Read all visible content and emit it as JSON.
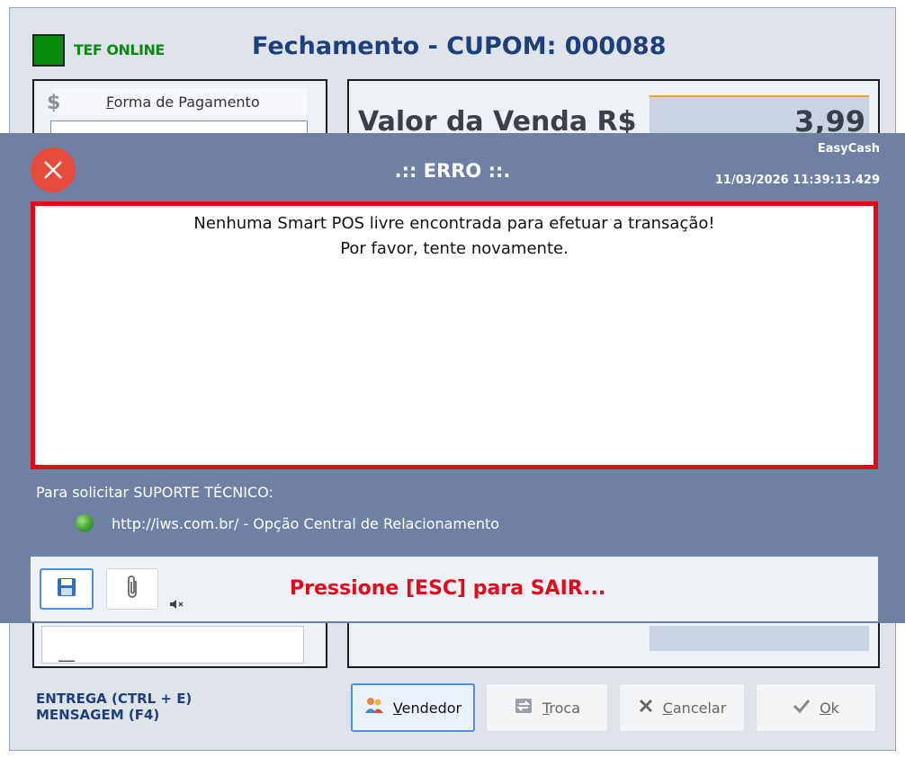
{
  "header": {
    "tef_status": "TEF ONLINE",
    "title": "Fechamento - CUPOM: 000088"
  },
  "left_panel": {
    "payment_label": "Forma de Pagamento",
    "payment_label_accel": "F",
    "payment_label_rest": "orma de Pagamento"
  },
  "right_panel": {
    "sale_label": "Valor da Venda R$",
    "sale_value": "3,99"
  },
  "shortcuts": {
    "delivery": "ENTREGA (CTRL + E)",
    "message": "MENSAGEM (F4)"
  },
  "buttons": {
    "vendedor": {
      "accel": "V",
      "rest": "endedor"
    },
    "troca": {
      "accel": "T",
      "rest": "roca"
    },
    "cancelar": {
      "accel": "C",
      "rest": "ancelar"
    },
    "ok": {
      "accel": "O",
      "rest": "k"
    }
  },
  "dialog": {
    "title": ".:: ERRO ::.",
    "app_name": "EasyCash",
    "timestamp": "11/03/2026 11:39:13.429",
    "message_line1": "Nenhuma Smart POS livre encontrada para efetuar a transação!",
    "message_line2": "Por favor, tente novamente.",
    "support_label": "Para solicitar SUPORTE TÉCNICO:",
    "support_link": "http://iws.com.br/ - Opção Central de Relacionamento",
    "exit_hint": "Pressione [ESC] para SAIR..."
  },
  "colors": {
    "error_red": "#e3091a",
    "dialog_bg": "#6e81a4",
    "title_blue": "#1e3f7a",
    "tef_green": "#0a8a0a"
  }
}
